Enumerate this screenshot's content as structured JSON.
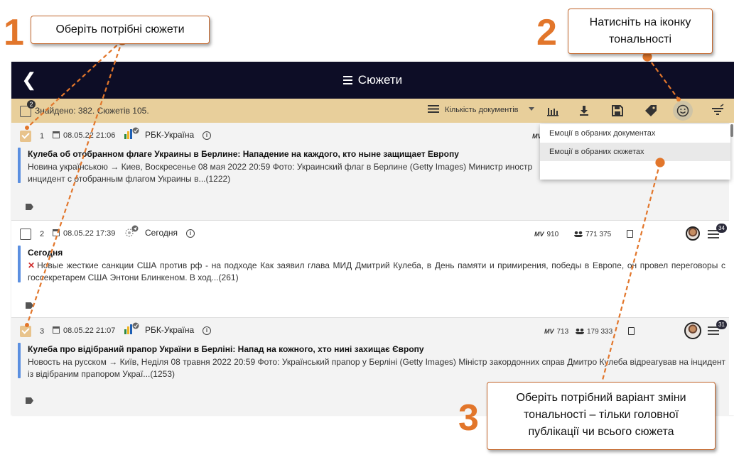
{
  "header": {
    "back_glyph": "❮",
    "title": "Сюжети"
  },
  "toolbar": {
    "selected_count": "2",
    "found_text": "Знайдено: 382. Сюжетів 105.",
    "sort_label": "Кількість документів"
  },
  "dropdown": {
    "items": [
      {
        "label": "Емоції в обраних документах"
      },
      {
        "label": "Емоції в обраних сюжетах"
      }
    ]
  },
  "rows": [
    {
      "checked": true,
      "num": "1",
      "date": "08.05.22 21:06",
      "source": "РБК-Україна",
      "mv_prefix": "MV",
      "headline": "Кулеба об отобранном флаге Украины в Берлине: Нападение на каждого, кто ныне защищает Европу",
      "snippet": "Новина українською → Киев, Воскресенье 08 мая 2022 20:59 Фото: Украинский флаг в Берлине (Getty Images) Министр иностр",
      "snippet2": "инцидент с отобранным флагом Украины в...(1222)"
    },
    {
      "checked": false,
      "num": "2",
      "date": "08.05.22 17:39",
      "source": "Сегодня",
      "mv_prefix": "MV",
      "mv": "910",
      "audience": "771 375",
      "badge": "34",
      "headline": "Сегодня",
      "snippet": "Новые жесткие санкции США против рф - на подходе Как заявил глава МИД Дмитрий Кулеба, в День памяти и примирения, победы в Европе, он провел переговоры с госсекретарем США Энтони Блинкеном. В ход...(261)"
    },
    {
      "checked": true,
      "num": "3",
      "date": "08.05.22 21:07",
      "source": "РБК-Україна",
      "mv_prefix": "MV",
      "mv": "713",
      "audience": "179 333",
      "badge": "31",
      "headline": "Кулеба про відібраний прапор України в Берліні: Напад на кожного, хто нині захищає Європу",
      "snippet": "Новость на русском → Київ, Неділя 08 травня 2022 20:59 Фото: Український прапор у Берліні (Getty Images) Міністр закордонних справ Дмитро Кулеба відреагував на інцидент із відібраним прапором Украї...(1253)"
    }
  ],
  "callouts": {
    "c1": {
      "num": "1",
      "text": "Оберіть потрібні сюжети"
    },
    "c2": {
      "num": "2",
      "line1": "Натисніть на іконку",
      "line2": "тональності"
    },
    "c3": {
      "num": "3",
      "line1": "Оберіть потрібний варіант зміни",
      "line2": "тональності – тільки головної",
      "line3": "публікації чи всього сюжета"
    }
  },
  "colors": {
    "topbar": "#0d0d26",
    "toolbar": "#e8cf9b",
    "accent_orange": "#e2762b",
    "row_bar": "#5b8fe0"
  }
}
